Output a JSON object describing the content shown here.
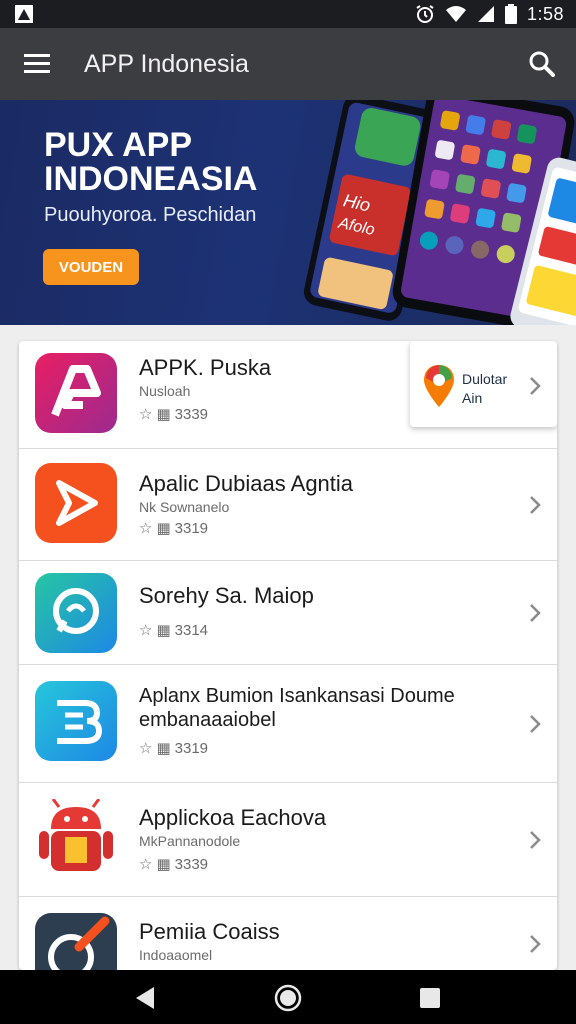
{
  "status": {
    "time": "1:58"
  },
  "app_bar": {
    "title": "APP Indonesia"
  },
  "banner": {
    "title": "PUX APP\nINDONEASIA",
    "subtitle": "Puouhyoroa. Peschidan",
    "button_label": "VOUDEN",
    "art_label": "Hio\nAfolo"
  },
  "promo": {
    "text": "Dulotar\nAin"
  },
  "apps": [
    {
      "title": "APPK. Puska",
      "subtitle": "Nusloah",
      "rating": "3339"
    },
    {
      "title": "Apalic Dubiaas Agntia",
      "subtitle": "Nk Sownanelo",
      "rating": "3319"
    },
    {
      "title": "Sorehy Sa. Maiop",
      "subtitle": "",
      "rating": "3314"
    },
    {
      "title": "Aplanx Bumion Isankansasi Doume",
      "title_line2": "embanaaaiobel",
      "subtitle": "",
      "rating": "3319"
    },
    {
      "title": "Applickoa Eachova",
      "subtitle": "MkPannanodole",
      "rating": "3339"
    },
    {
      "title": "Pemiia Coaiss",
      "subtitle": "Indoaaomel",
      "rating": ""
    }
  ],
  "colors": {
    "accent": "#f7941d",
    "app_bar": "#3b3d41",
    "banner": "#1d3275"
  }
}
